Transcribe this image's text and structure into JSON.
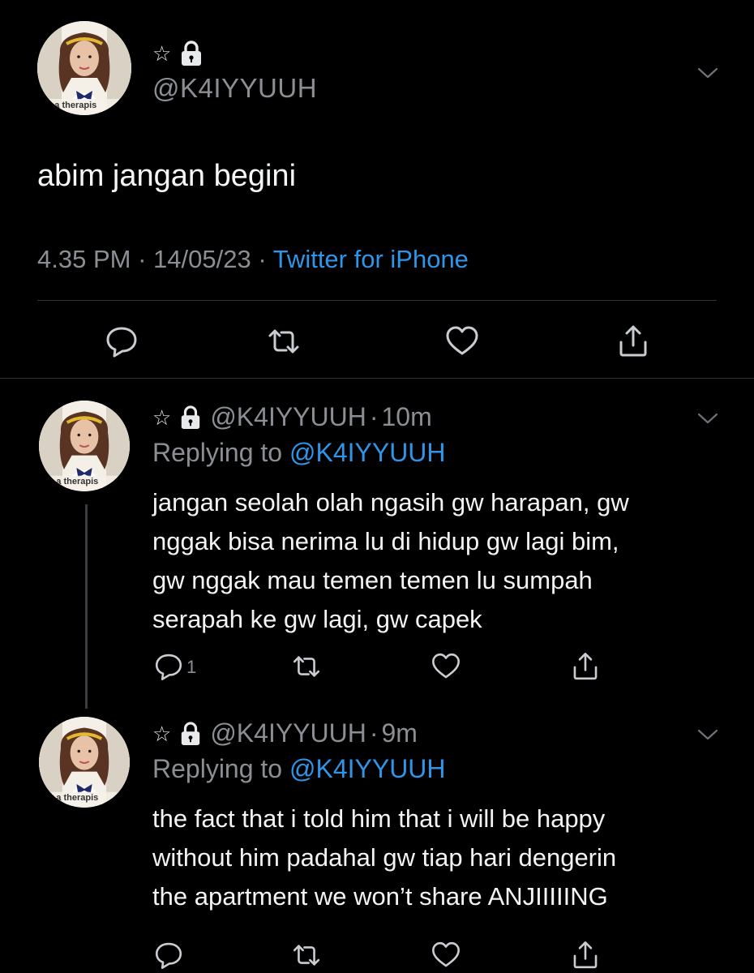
{
  "main_tweet": {
    "badge_star": "☆",
    "handle": "@K4IYYUUH",
    "text": "abim jangan begini",
    "time": "4.35 PM",
    "date": "14/05/23",
    "source": "Twitter for iPhone",
    "avatar_caption": "ee a therapis"
  },
  "replies": [
    {
      "badge_star": "☆",
      "handle": "@K4IYYUUH",
      "age": "10m",
      "replying_label": "Replying to",
      "replying_to": "@K4IYYUUH",
      "lines": [
        "jangan seolah olah ngasih gw harapan, gw",
        "nggak bisa nerima lu di hidup gw lagi bim,",
        "gw nggak mau temen temen lu sumpah",
        "serapah ke gw lagi, gw capek"
      ],
      "reply_count": "1",
      "avatar_caption": "ee a therapis"
    },
    {
      "badge_star": "☆",
      "handle": "@K4IYYUUH",
      "age": "9m",
      "replying_label": "Replying to",
      "replying_to": "@K4IYYUUH",
      "lines": [
        "the fact that i told him that i will be happy",
        "without him padahal gw tiap hari dengerin",
        "the apartment we won’t share ANJIIIIING"
      ],
      "avatar_caption": "ee a therapis"
    }
  ],
  "colors": {
    "background": "#000000",
    "text": "#e7e9ea",
    "muted": "#8b8f94",
    "link": "#2f95e8",
    "divider": "#2f3336"
  },
  "icons": [
    "star-badge-icon",
    "lock-icon",
    "chevron-down-icon",
    "reply-icon",
    "retweet-icon",
    "like-icon",
    "share-icon"
  ]
}
